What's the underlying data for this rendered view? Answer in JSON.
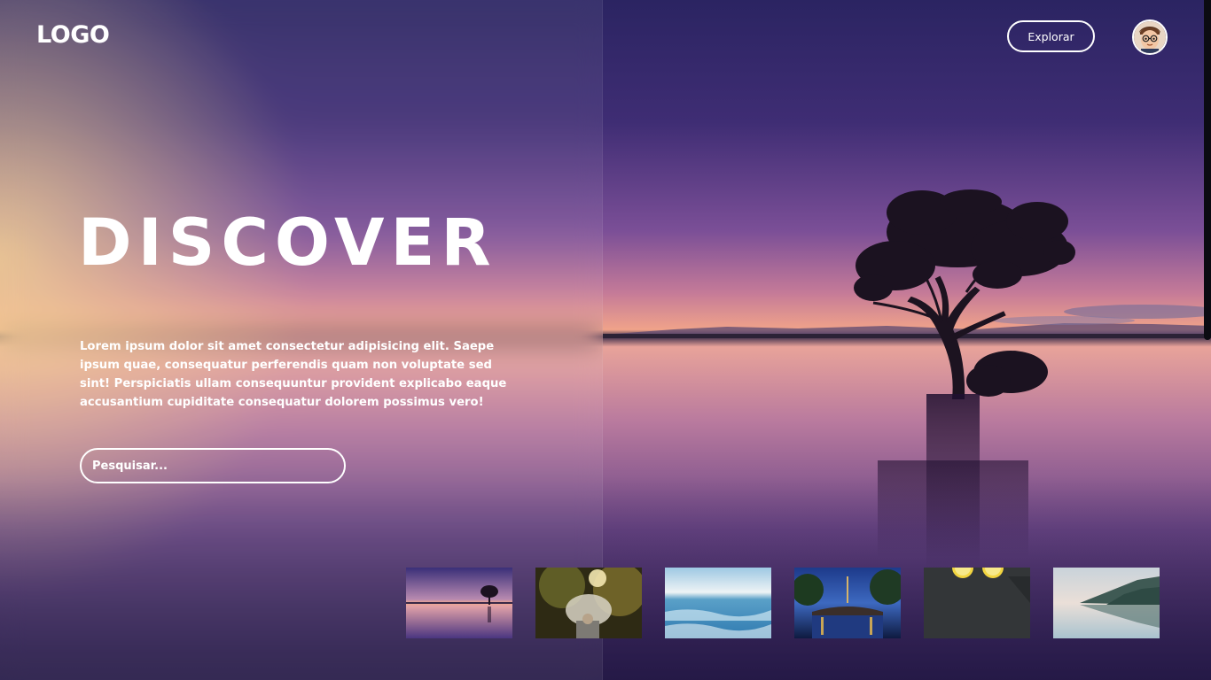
{
  "header": {
    "logo": "LOGO",
    "explore_label": "Explorar",
    "avatar_icon": "user-avatar-icon"
  },
  "hero": {
    "title": "DISCOVER",
    "description": "Lorem ipsum dolor sit amet consectetur adipisicing elit. Saepe ipsum quae, consequatur perferendis quam non voluptate sed sint! Perspiciatis ullam consequuntur provident explicabo eaque accusantium cupiditate consequatur dolorem possimus vero!",
    "search_placeholder": "Pesquisar..."
  },
  "thumbnails": [
    {
      "name": "thumbnail-sunset-tree"
    },
    {
      "name": "thumbnail-umbrella-forest"
    },
    {
      "name": "thumbnail-ocean-waves"
    },
    {
      "name": "thumbnail-night-bridge"
    },
    {
      "name": "thumbnail-lemons-slate"
    },
    {
      "name": "thumbnail-mountain-lake"
    }
  ],
  "colors": {
    "sky_top": "#2a2360",
    "sky_mid": "#8a5aa8",
    "horizon": "#f3a28a",
    "water": "#c98aa0",
    "text": "#ffffff"
  }
}
